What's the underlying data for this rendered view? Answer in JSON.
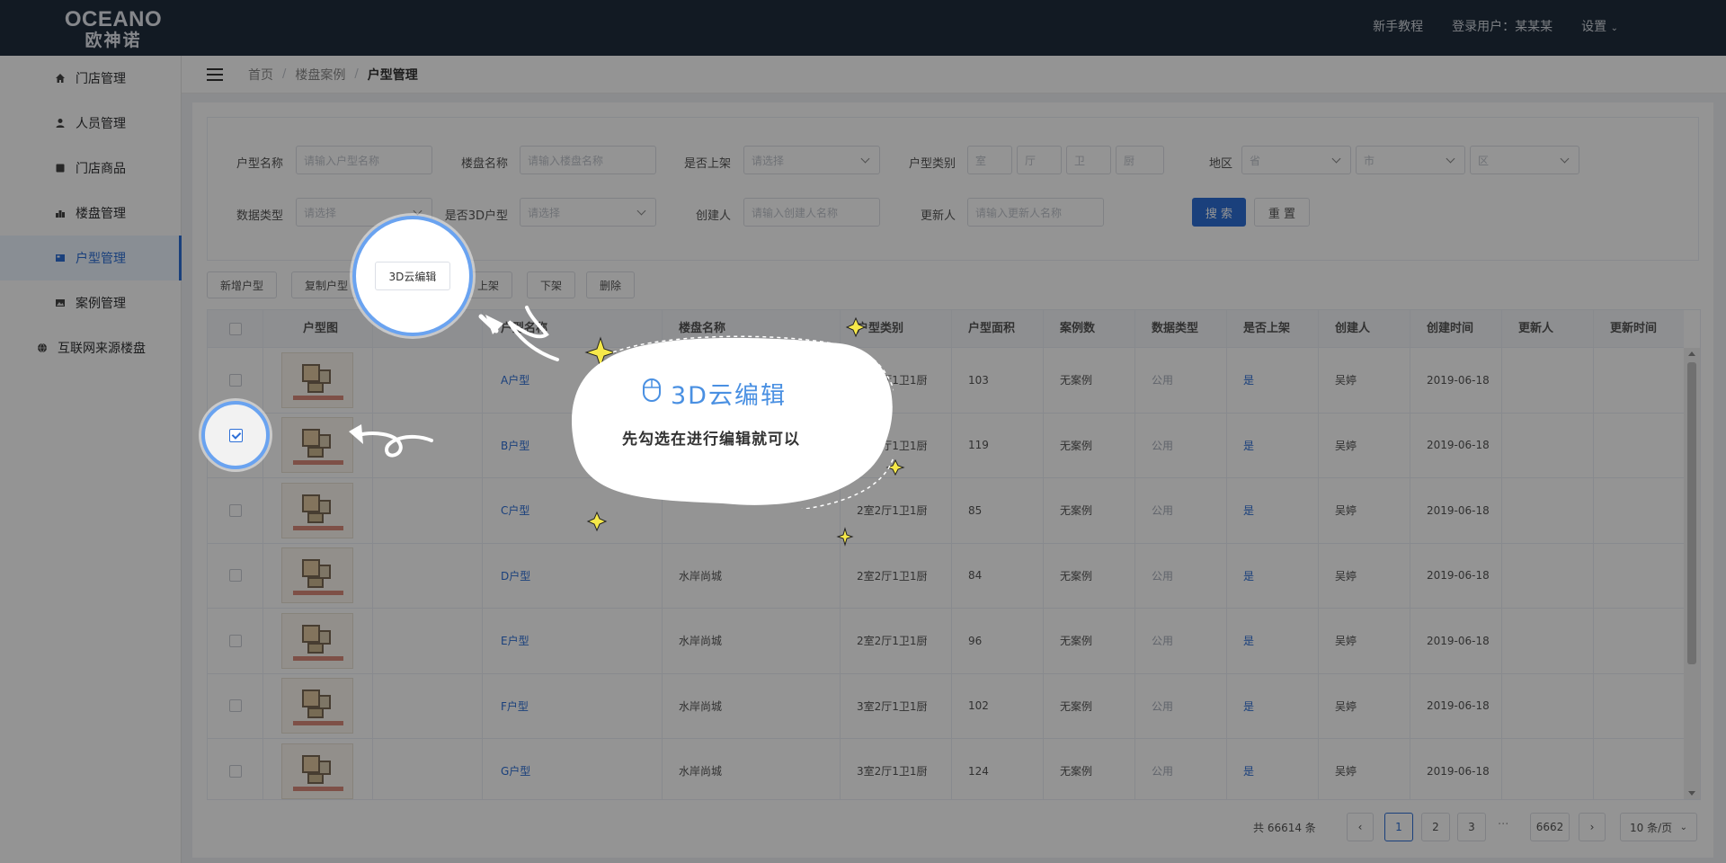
{
  "header": {
    "logo_en": "OCEANO",
    "logo_cn": "欧神诺",
    "links": {
      "tutorial": "新手教程",
      "user": "登录用户：某某某",
      "settings": "设置"
    }
  },
  "sidebar": {
    "items": [
      {
        "label": "门店管理",
        "icon": "home-icon"
      },
      {
        "label": "人员管理",
        "icon": "user-icon"
      },
      {
        "label": "门店商品",
        "icon": "box-icon"
      },
      {
        "label": "楼盘管理",
        "icon": "bar-chart-icon"
      },
      {
        "label": "户型管理",
        "icon": "image-icon",
        "active": true
      },
      {
        "label": "案例管理",
        "icon": "picture-icon"
      },
      {
        "label": "互联网来源楼盘",
        "icon": "globe-icon"
      }
    ]
  },
  "breadcrumb": [
    "首页",
    "楼盘案例",
    "户型管理"
  ],
  "filters": {
    "unit_name": {
      "label": "户型名称",
      "placeholder": "请输入户型名称"
    },
    "building_name": {
      "label": "楼盘名称",
      "placeholder": "请输入楼盘名称"
    },
    "listed": {
      "label": "是否上架",
      "placeholder": "请选择"
    },
    "unit_type": {
      "label": "户型类别",
      "room": "室",
      "hall": "厅",
      "bath": "卫",
      "kitchen": "厨"
    },
    "region": {
      "label": "地区",
      "province": "省",
      "city": "市",
      "district": "区"
    },
    "data_type": {
      "label": "数据类型",
      "placeholder": "请选择"
    },
    "is_3d": {
      "label": "是否3D户型",
      "placeholder": "请选择"
    },
    "creator": {
      "label": "创建人",
      "placeholder": "请输入创建人名称"
    },
    "updater": {
      "label": "更新人",
      "placeholder": "请输入更新人名称"
    },
    "search_btn": "搜 索",
    "reset_btn": "重 置"
  },
  "toolbar": {
    "add": "新增户型",
    "copy": "复制户型",
    "cloud_edit": "3D云编辑",
    "list": "上架",
    "unlist": "下架",
    "delete": "删除"
  },
  "table": {
    "columns": [
      "户型图",
      "户型名称",
      "楼盘名称",
      "户型类别",
      "户型面积",
      "案例数",
      "数据类型",
      "是否上架",
      "创建人",
      "创建时间",
      "更新人",
      "更新时间"
    ],
    "rows": [
      {
        "name": "A户型",
        "building": "",
        "type": "2室2厅1卫1厨",
        "area": "103",
        "cases": "无案例",
        "data_type": "公用",
        "listed": "是",
        "creator": "吴婷",
        "created": "2019-06-18",
        "updater": "",
        "updated": ""
      },
      {
        "name": "B户型",
        "building": "",
        "type": "2室2厅1卫1厨",
        "area": "119",
        "cases": "无案例",
        "data_type": "公用",
        "listed": "是",
        "creator": "吴婷",
        "created": "2019-06-18",
        "updater": "",
        "updated": ""
      },
      {
        "name": "C户型",
        "building": "",
        "type": "2室2厅1卫1厨",
        "area": "85",
        "cases": "无案例",
        "data_type": "公用",
        "listed": "是",
        "creator": "吴婷",
        "created": "2019-06-18",
        "updater": "",
        "updated": ""
      },
      {
        "name": "D户型",
        "building": "水岸尚城",
        "type": "2室2厅1卫1厨",
        "area": "84",
        "cases": "无案例",
        "data_type": "公用",
        "listed": "是",
        "creator": "吴婷",
        "created": "2019-06-18",
        "updater": "",
        "updated": ""
      },
      {
        "name": "E户型",
        "building": "水岸尚城",
        "type": "2室2厅1卫1厨",
        "area": "96",
        "cases": "无案例",
        "data_type": "公用",
        "listed": "是",
        "creator": "吴婷",
        "created": "2019-06-18",
        "updater": "",
        "updated": ""
      },
      {
        "name": "F户型",
        "building": "水岸尚城",
        "type": "3室2厅1卫1厨",
        "area": "102",
        "cases": "无案例",
        "data_type": "公用",
        "listed": "是",
        "creator": "吴婷",
        "created": "2019-06-18",
        "updater": "",
        "updated": ""
      },
      {
        "name": "G户型",
        "building": "水岸尚城",
        "type": "3室2厅1卫1厨",
        "area": "124",
        "cases": "无案例",
        "data_type": "公用",
        "listed": "是",
        "creator": "吴婷",
        "created": "2019-06-18",
        "updater": "",
        "updated": ""
      }
    ]
  },
  "pagination": {
    "total": "共 66614 条",
    "pages": [
      "1",
      "2",
      "3"
    ],
    "ellipsis": "···",
    "last_page": "6662",
    "page_size": "10 条/页",
    "current": "1"
  },
  "callout": {
    "title": "3D云编辑",
    "subtitle": "先勾选在进行编辑就可以",
    "title_color": "#4a90e2",
    "highlight_color": "#6aa3f0"
  },
  "colors": {
    "primary": "#2d6fd6",
    "header_bg": "#1f2d3d"
  }
}
